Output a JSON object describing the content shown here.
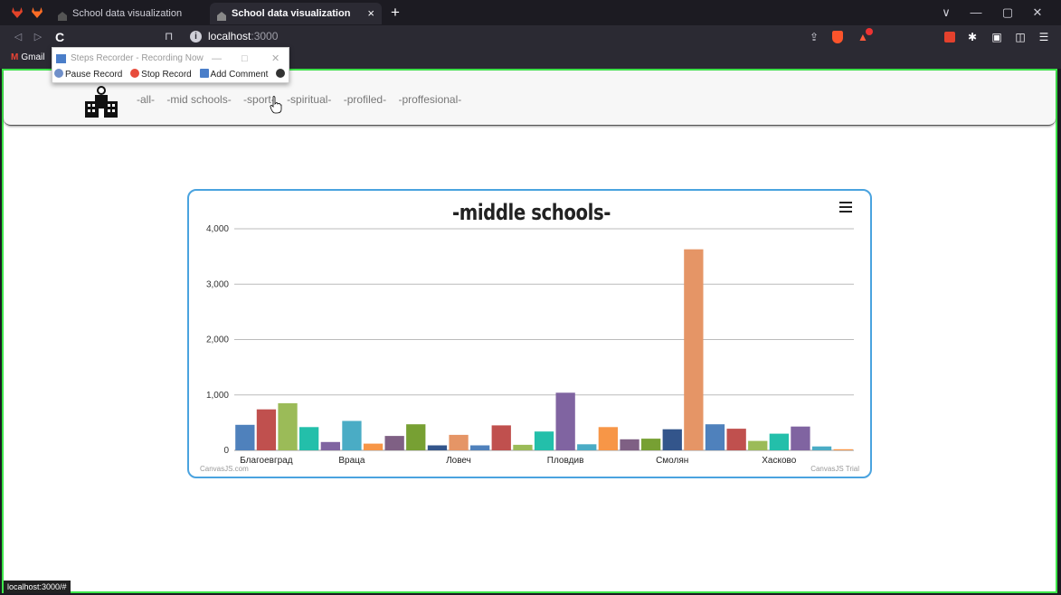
{
  "browser": {
    "tabs": [
      {
        "title": "School data visualization",
        "active": false
      },
      {
        "title": "School data visualization",
        "active": true
      }
    ],
    "new_tab": "+",
    "tab_close": "×",
    "url_host": "localhost",
    "url_port": ":3000",
    "bookmarks": [
      {
        "label": "Gmail"
      }
    ],
    "status_url": "localhost:3000/#",
    "window_controls": {
      "dropdown": "∨",
      "minimize": "—",
      "restore": "▢",
      "close": "✕"
    },
    "nav": {
      "back": "◁",
      "forward": "▷",
      "reload": "C",
      "bookmark": "⊓",
      "info": "i"
    },
    "toolbar_icons": [
      "share-icon",
      "brave-shield-icon",
      "brave-rewards-icon",
      "extension-red-icon",
      "puzzle-icon",
      "sidebar-icon",
      "wallet-icon",
      "menu-icon"
    ],
    "accent_color": "#3ee64a"
  },
  "recorder": {
    "title": "Steps Recorder - Recording Now",
    "pause": "Pause Record",
    "stop": "Stop Record",
    "comment": "Add Comment",
    "minimize": "—",
    "maximize": "□",
    "close": "✕"
  },
  "site": {
    "nav_links": [
      "-all-",
      "-mid schools-",
      "-sport-",
      "-spiritual-",
      "-profiled-",
      "-proffesional-"
    ]
  },
  "chart_data": {
    "type": "bar",
    "title": "-middle schools-",
    "ylim": [
      0,
      4000
    ],
    "yticks": [
      "0",
      "1,000",
      "2,000",
      "3,000",
      "4,000"
    ],
    "y_tick_values": [
      0,
      1000,
      2000,
      3000,
      4000
    ],
    "grid": true,
    "x_labels": [
      {
        "index": 1,
        "label": "Благоевград"
      },
      {
        "index": 5,
        "label": "Враца"
      },
      {
        "index": 10,
        "label": "Ловеч"
      },
      {
        "index": 15,
        "label": "Пловдив"
      },
      {
        "index": 20,
        "label": "Смолян"
      },
      {
        "index": 25,
        "label": "Хасково"
      }
    ],
    "values": [
      460,
      740,
      850,
      420,
      150,
      530,
      120,
      260,
      470,
      90,
      280,
      90,
      450,
      100,
      340,
      1040,
      110,
      420,
      200,
      210,
      380,
      3630,
      470,
      390,
      170,
      300,
      430,
      70,
      20
    ],
    "colors": [
      "#4f81bc",
      "#c0504e",
      "#9bbb58",
      "#23bfaa",
      "#8064a1",
      "#4aacc5",
      "#f79647",
      "#7f6084",
      "#77a033",
      "#33558b",
      "#e59566",
      "#4f81bc",
      "#c0504e",
      "#9bbb58",
      "#23bfaa",
      "#8064a1",
      "#4aacc5",
      "#f79647",
      "#7f6084",
      "#77a033",
      "#33558b",
      "#e59566",
      "#4f81bc",
      "#c0504e",
      "#9bbb58",
      "#23bfaa",
      "#8064a1",
      "#4aacc5",
      "#f79647"
    ],
    "credit_left": "CanvasJS.com",
    "credit_right": "CanvasJS Trial"
  }
}
